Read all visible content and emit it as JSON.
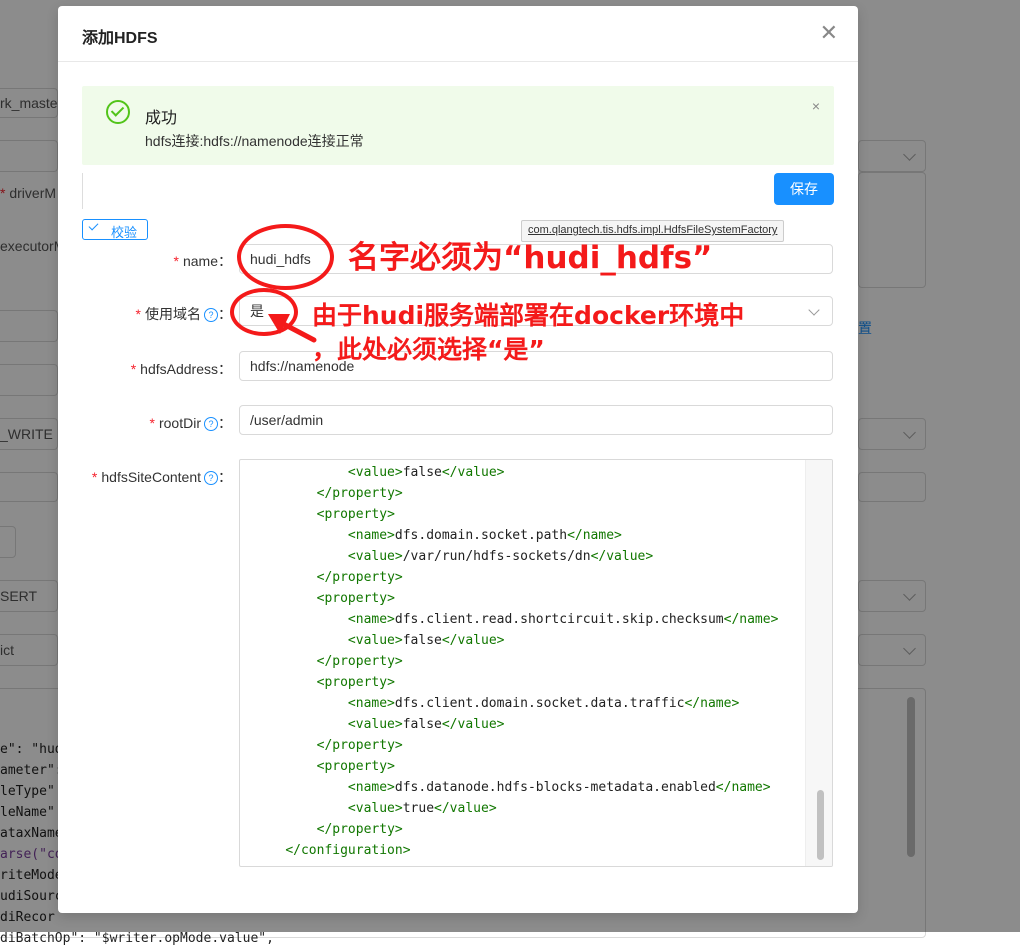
{
  "background": {
    "texts": [
      "rk_master",
      "driverM",
      "executorM",
      "_WRITE",
      "SERT",
      "ict",
      "置"
    ],
    "code_lines": [
      [
        "e\": \"hud",
        ""
      ],
      [
        "ameter\":",
        ""
      ],
      [
        "leType\"",
        ""
      ],
      [
        "leName\"",
        ""
      ],
      [
        "ataxName",
        ""
      ],
      [
        "arse(\"co",
        ""
      ],
      [
        "riteMode",
        ""
      ],
      [
        "udiSourc",
        ""
      ],
      [
        "diRecor",
        ""
      ],
      [
        "diBatchOp\": \"$writer.opMode.value\",",
        ""
      ]
    ]
  },
  "modal": {
    "title": "添加HDFS",
    "close_icon": "close-icon",
    "alert": {
      "title": "成功",
      "description": "hdfs连接:hdfs://namenode连接正常",
      "close": "×"
    },
    "save_label": "保存",
    "verify_label": "校验",
    "plugin_tooltip": "com.qlangtech.tis.hdfs.impl.HdfsFileSystemFactory",
    "fields": {
      "name": {
        "label": "name",
        "value": "hudi_hdfs"
      },
      "use_hostname": {
        "label": "使用域名",
        "value": "是"
      },
      "hdfs_address": {
        "label": "hdfsAddress",
        "value": "hdfs://namenode"
      },
      "root_dir": {
        "label": "rootDir",
        "value": "/user/admin"
      },
      "site_content": {
        "label": "hdfsSiteContent"
      }
    },
    "code_lines": [
      [
        "            ",
        "<value>",
        "false",
        "</value>"
      ],
      [
        "        ",
        "</property>",
        "",
        ""
      ],
      [
        "        ",
        "<property>",
        "",
        ""
      ],
      [
        "            ",
        "<name>",
        "dfs.domain.socket.path",
        "</name>"
      ],
      [
        "            ",
        "<value>",
        "/var/run/hdfs-sockets/dn",
        "</value>"
      ],
      [
        "        ",
        "</property>",
        "",
        ""
      ],
      [
        "        ",
        "<property>",
        "",
        ""
      ],
      [
        "            ",
        "<name>",
        "dfs.client.read.shortcircuit.skip.checksum",
        "</name>"
      ],
      [
        "            ",
        "<value>",
        "false",
        "</value>"
      ],
      [
        "        ",
        "</property>",
        "",
        ""
      ],
      [
        "        ",
        "<property>",
        "",
        ""
      ],
      [
        "            ",
        "<name>",
        "dfs.client.domain.socket.data.traffic",
        "</name>"
      ],
      [
        "            ",
        "<value>",
        "false",
        "</value>"
      ],
      [
        "        ",
        "</property>",
        "",
        ""
      ],
      [
        "        ",
        "<property>",
        "",
        ""
      ],
      [
        "            ",
        "<name>",
        "dfs.datanode.hdfs-blocks-metadata.enabled",
        "</name>"
      ],
      [
        "            ",
        "<value>",
        "true",
        "</value>"
      ],
      [
        "        ",
        "</property>",
        "",
        ""
      ],
      [
        "    ",
        "</configuration>",
        "",
        ""
      ]
    ]
  },
  "annotations": {
    "name_note": "名字必须为“hudi_hdfs”",
    "domain_note_line1": "由于hudi服务端部署在docker环境中",
    "domain_note_line2": "，此处必须选择“是”"
  },
  "colors": {
    "primary": "#1890ff",
    "success": "#52c41a",
    "annotation": "#f41a1a",
    "required": "#f5222d"
  }
}
